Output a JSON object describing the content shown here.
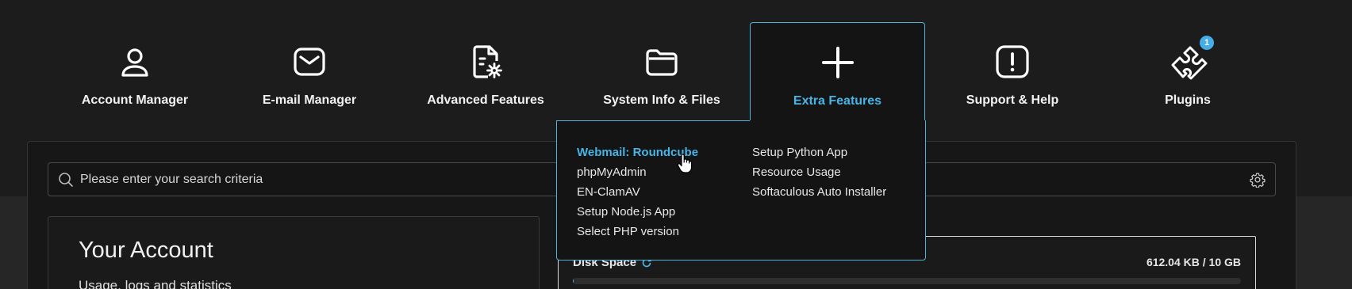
{
  "nav": {
    "items": [
      {
        "label": "Account Manager",
        "icon": "user-icon"
      },
      {
        "label": "E-mail Manager",
        "icon": "envelope-icon"
      },
      {
        "label": "Advanced Features",
        "icon": "document-gear-icon"
      },
      {
        "label": "System Info & Files",
        "icon": "folder-icon"
      },
      {
        "label": "Extra Features",
        "icon": "plus-icon",
        "active": true
      },
      {
        "label": "Support & Help",
        "icon": "exclamation-icon"
      },
      {
        "label": "Plugins",
        "icon": "puzzle-icon",
        "badge": "1"
      }
    ]
  },
  "dropdown": {
    "col1": [
      "Webmail: Roundcube",
      "phpMyAdmin",
      "EN-ClamAV",
      "Setup Node.js App",
      "Select PHP version"
    ],
    "col2": [
      "Setup Python App",
      "Resource Usage",
      "Softaculous Auto Installer"
    ],
    "highlighted": "Webmail: Roundcube"
  },
  "search": {
    "placeholder": "Please enter your search criteria"
  },
  "account": {
    "title": "Your Account",
    "subtitle": "Usage, logs and statistics"
  },
  "disk": {
    "label": "Disk Space",
    "value": "612.04 KB / 10 GB",
    "used_fraction": 0.0001
  },
  "colors": {
    "accent": "#47b5e6",
    "bg": "#1c1c1d"
  }
}
